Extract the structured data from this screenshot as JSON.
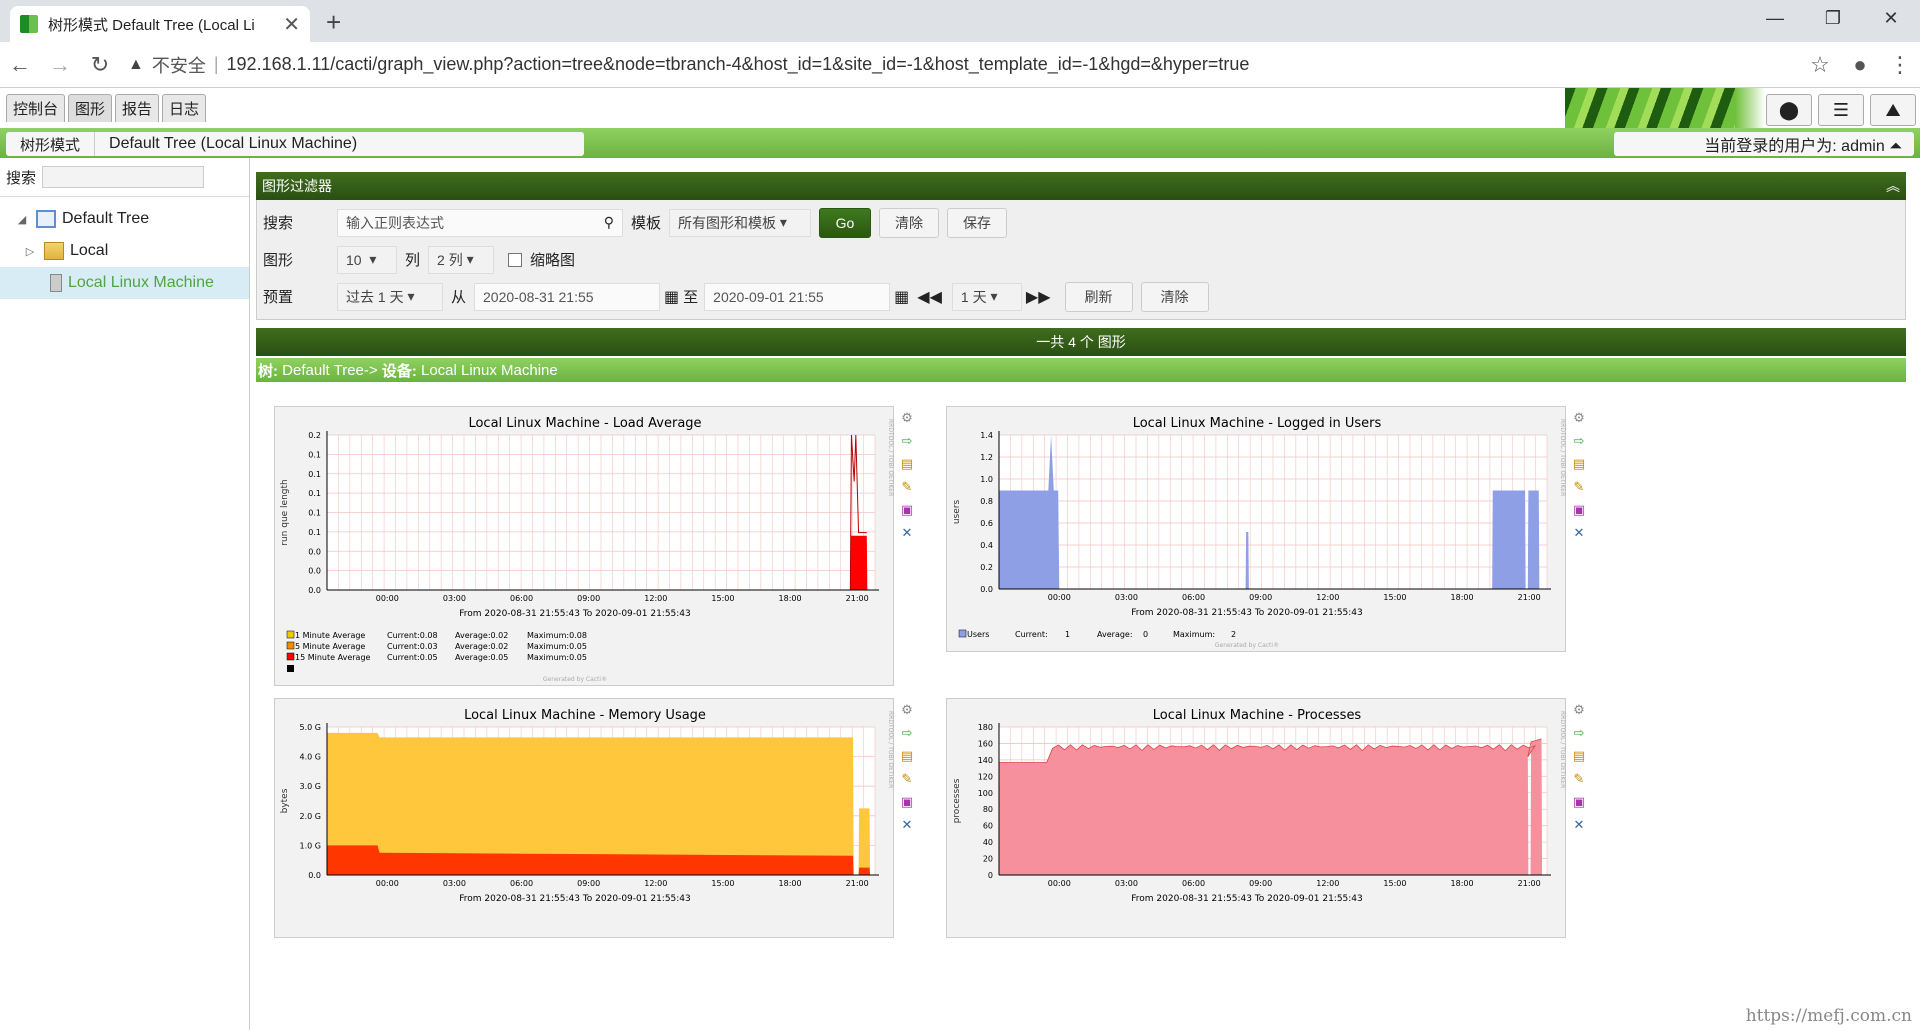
{
  "browser": {
    "tab_title": "树形模式 Default Tree (Local Li",
    "insecure": "不安全",
    "url": "192.168.1.11/cacti/graph_view.php?action=tree&node=tbranch-4&host_id=1&site_id=-1&host_template_id=-1&hgd=&hyper=true"
  },
  "nav": {
    "tabs": [
      "控制台",
      "图形",
      "报告",
      "日志"
    ],
    "crumb_mode": "树形模式",
    "crumb_tree": "Default Tree (Local Linux Machine)",
    "user_label": "当前登录的用户为: admin ⏶"
  },
  "sidebar": {
    "search_label": "搜索",
    "tree_root": "Default Tree",
    "branch": "Local",
    "device": "Local Linux Machine"
  },
  "filter": {
    "title": "图形过滤器",
    "search_label": "搜索",
    "search_placeholder": "输入正则表达式",
    "template_label": "模板",
    "template_value": "所有图形和模板",
    "go": "Go",
    "clear": "清除",
    "save": "保存",
    "graphs_label": "图形",
    "graphs_value": "10",
    "columns_label": "列",
    "columns_value": "2 列",
    "thumbnails": "缩略图",
    "preset_label": "预置",
    "preset_value": "过去 1 天",
    "from_label": "从",
    "from_value": "2020-08-31 21:55",
    "to_label": "至",
    "to_value": "2020-09-01 21:55",
    "step_value": "1 天",
    "refresh": "刷新",
    "clear2": "清除"
  },
  "results": {
    "total": "一共 4 个 图形",
    "tree_prefix": "树:",
    "tree_name": "Default Tree->",
    "device_prefix": "设备:",
    "device_name": "Local Linux Machine"
  },
  "watermark": "https://mefj.com.cn",
  "colors": {
    "load1": "#EACC00",
    "load5": "#EA8F00",
    "load15": "#FF0000",
    "users": "#8F9FE6",
    "mem_free": "#FFC73B",
    "mem_used": "#FF3600",
    "processes": "#F5909C",
    "header_dark": "#2a4f12",
    "header_light": "#6cb33e"
  },
  "graphs": [
    {
      "title": "Local Linux Machine - Load Average",
      "ylabel": "run que length",
      "yticks": [
        "0.2",
        "0.1",
        "0.1",
        "0.1",
        "0.1",
        "0.1",
        "0.0",
        "0.0",
        "0.0"
      ],
      "xticks": [
        "00:00",
        "03:00",
        "06:00",
        "09:00",
        "12:00",
        "15:00",
        "18:00",
        "21:00"
      ],
      "period": "From 2020-08-31 21:55:43 To 2020-09-01 21:55:43",
      "legend": [
        {
          "name": "1 Minute Average",
          "current": "Current:0.08",
          "average": "Average:0.02",
          "maximum": "Maximum:0.08"
        },
        {
          "name": "5 Minute Average",
          "current": "Current:0.03",
          "average": "Average:0.02",
          "maximum": "Maximum:0.05"
        },
        {
          "name": "15 Minute Average",
          "current": "Current:0.05",
          "average": "Average:0.05",
          "maximum": "Maximum:0.05"
        }
      ],
      "generated": "Generated by Cacti®"
    },
    {
      "title": "Local Linux Machine - Logged in Users",
      "ylabel": "users",
      "yticks": [
        "1.4",
        "1.2",
        "1.0",
        "0.8",
        "0.6",
        "0.4",
        "0.2",
        "0.0"
      ],
      "xticks": [
        "00:00",
        "03:00",
        "06:00",
        "09:00",
        "12:00",
        "15:00",
        "18:00",
        "21:00"
      ],
      "period": "From 2020-08-31 21:55:43 To 2020-09-01 21:55:43",
      "legend": [
        {
          "name": "Users",
          "current": "Current:",
          "current_val": "1",
          "average": "Average:",
          "average_val": "0",
          "maximum": "Maximum:",
          "maximum_val": "2"
        }
      ],
      "generated": "Generated by Cacti®"
    },
    {
      "title": "Local Linux Machine - Memory Usage",
      "ylabel": "bytes",
      "yticks": [
        "5.0 G",
        "4.0 G",
        "3.0 G",
        "2.0 G",
        "1.0 G",
        "0.0"
      ],
      "xticks": [
        "00:00",
        "03:00",
        "06:00",
        "09:00",
        "12:00",
        "15:00",
        "18:00",
        "21:00"
      ],
      "period": "From 2020-08-31 21:55:43 To 2020-09-01 21:55:43"
    },
    {
      "title": "Local Linux Machine - Processes",
      "ylabel": "processes",
      "yticks": [
        "180",
        "160",
        "140",
        "120",
        "100",
        "80",
        "60",
        "40",
        "20",
        "0"
      ],
      "xticks": [
        "00:00",
        "03:00",
        "06:00",
        "09:00",
        "12:00",
        "15:00",
        "18:00",
        "21:00"
      ],
      "period": "From 2020-08-31 21:55:43 To 2020-09-01 21:55:43"
    }
  ],
  "graph_side": "RRDTOOL / TOBI OETIKER"
}
